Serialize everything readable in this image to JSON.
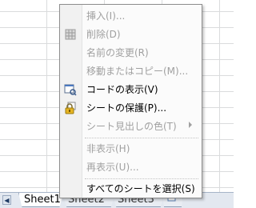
{
  "menu": {
    "items": [
      {
        "label": "挿入(I)...",
        "disabled": true,
        "icon": ""
      },
      {
        "label": "削除(D)",
        "disabled": true,
        "icon": "delete-sheet-icon"
      },
      {
        "label": "名前の変更(R)",
        "disabled": true,
        "icon": ""
      },
      {
        "label": "移動またはコピー(M)...",
        "disabled": true,
        "icon": ""
      },
      {
        "label": "コードの表示(V)",
        "disabled": false,
        "icon": "view-code-icon"
      },
      {
        "label": "シートの保護(P)...",
        "disabled": false,
        "icon": "protect-sheet-lock-icon"
      },
      {
        "label": "シート見出しの色(T)",
        "disabled": true,
        "icon": "",
        "submenu": true
      },
      {
        "label": "非表示(H)",
        "disabled": true,
        "icon": ""
      },
      {
        "label": "再表示(U)...",
        "disabled": true,
        "icon": ""
      },
      {
        "label": "すべてのシートを選択(S)",
        "disabled": false,
        "icon": ""
      }
    ]
  },
  "tabs": {
    "nav_prev": "◀",
    "nav_next": "▶",
    "sheets": [
      {
        "label": "Sheet1",
        "active": true
      },
      {
        "label": "Sheet2",
        "active": false
      },
      {
        "label": "Sheet3",
        "active": false
      }
    ],
    "new_sheet_icon": "insert-sheet-icon"
  }
}
